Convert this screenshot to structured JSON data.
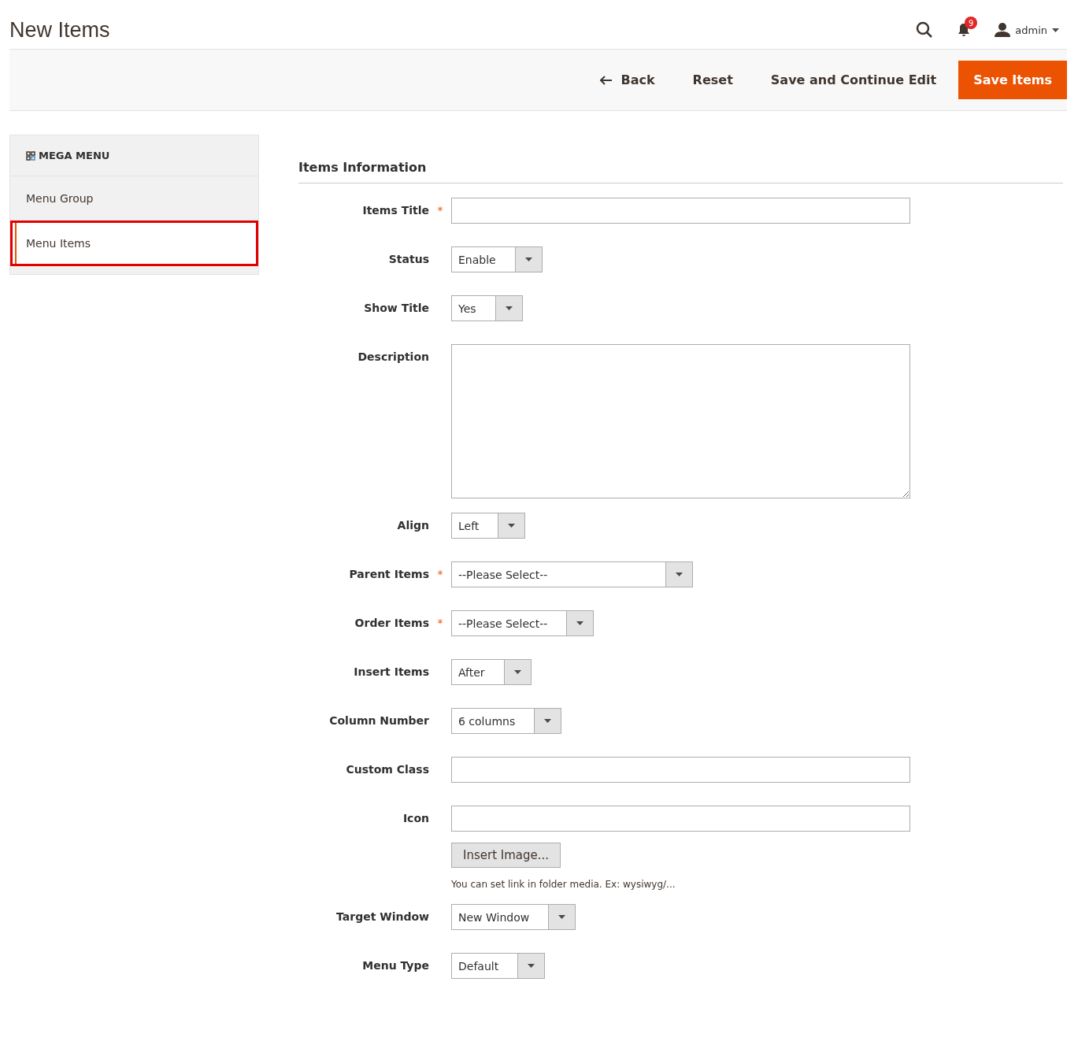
{
  "page_title": "New Items",
  "header": {
    "notification_count": "9",
    "user": "admin"
  },
  "actions": [
    {
      "label": "Back",
      "kind": "back"
    },
    {
      "label": "Reset",
      "kind": "plain"
    },
    {
      "label": "Save and Continue Edit",
      "kind": "plain"
    },
    {
      "label": "Save Items",
      "kind": "primary"
    }
  ],
  "sidebar": {
    "title": "MEGA MENU",
    "items": [
      {
        "label": "Menu Group",
        "selected": false
      },
      {
        "label": "Menu Items",
        "selected": true
      }
    ]
  },
  "section_title": "Items Information",
  "fields": [
    {
      "label": "Items Title",
      "kind": "text",
      "required_mark": "*"
    },
    {
      "label": "Status",
      "kind": "select",
      "value": "Enable"
    },
    {
      "label": "Show Title",
      "kind": "select",
      "value": "Yes"
    },
    {
      "label": "Description",
      "kind": "textarea"
    },
    {
      "label": "Align",
      "kind": "select",
      "value": "Left"
    },
    {
      "label": "Parent Items",
      "kind": "select",
      "value": "--Please Select--",
      "required_mark": "*"
    },
    {
      "label": "Order Items",
      "kind": "select",
      "value": "--Please Select--",
      "required_mark": "*"
    },
    {
      "label": "Insert Items",
      "kind": "select",
      "value": "After"
    },
    {
      "label": "Column Number",
      "kind": "select",
      "value": "6 columns"
    },
    {
      "label": "Custom Class",
      "kind": "text"
    },
    {
      "label": "Icon",
      "kind": "image",
      "button": "Insert Image...",
      "note": "You can set link in folder media. Ex: wysiwyg/..."
    },
    {
      "label": "Target Window",
      "kind": "select",
      "value": "New Window"
    },
    {
      "label": "Menu Type",
      "kind": "select",
      "value": "Default"
    }
  ]
}
